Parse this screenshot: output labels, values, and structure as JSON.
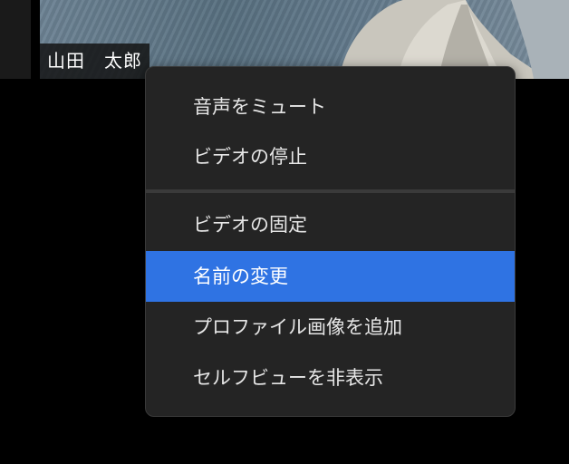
{
  "colors": {
    "menu_background": "#242424",
    "highlight": "#2f73e3",
    "text": "#e6e6e6"
  },
  "participant": {
    "name": "山田　太郎"
  },
  "context_menu": {
    "items": [
      {
        "label": "音声をミュート"
      },
      {
        "label": "ビデオの停止"
      },
      {
        "label": "ビデオの固定"
      },
      {
        "label": "名前の変更",
        "highlighted": true
      },
      {
        "label": "プロファイル画像を追加"
      },
      {
        "label": "セルフビューを非表示"
      }
    ]
  }
}
